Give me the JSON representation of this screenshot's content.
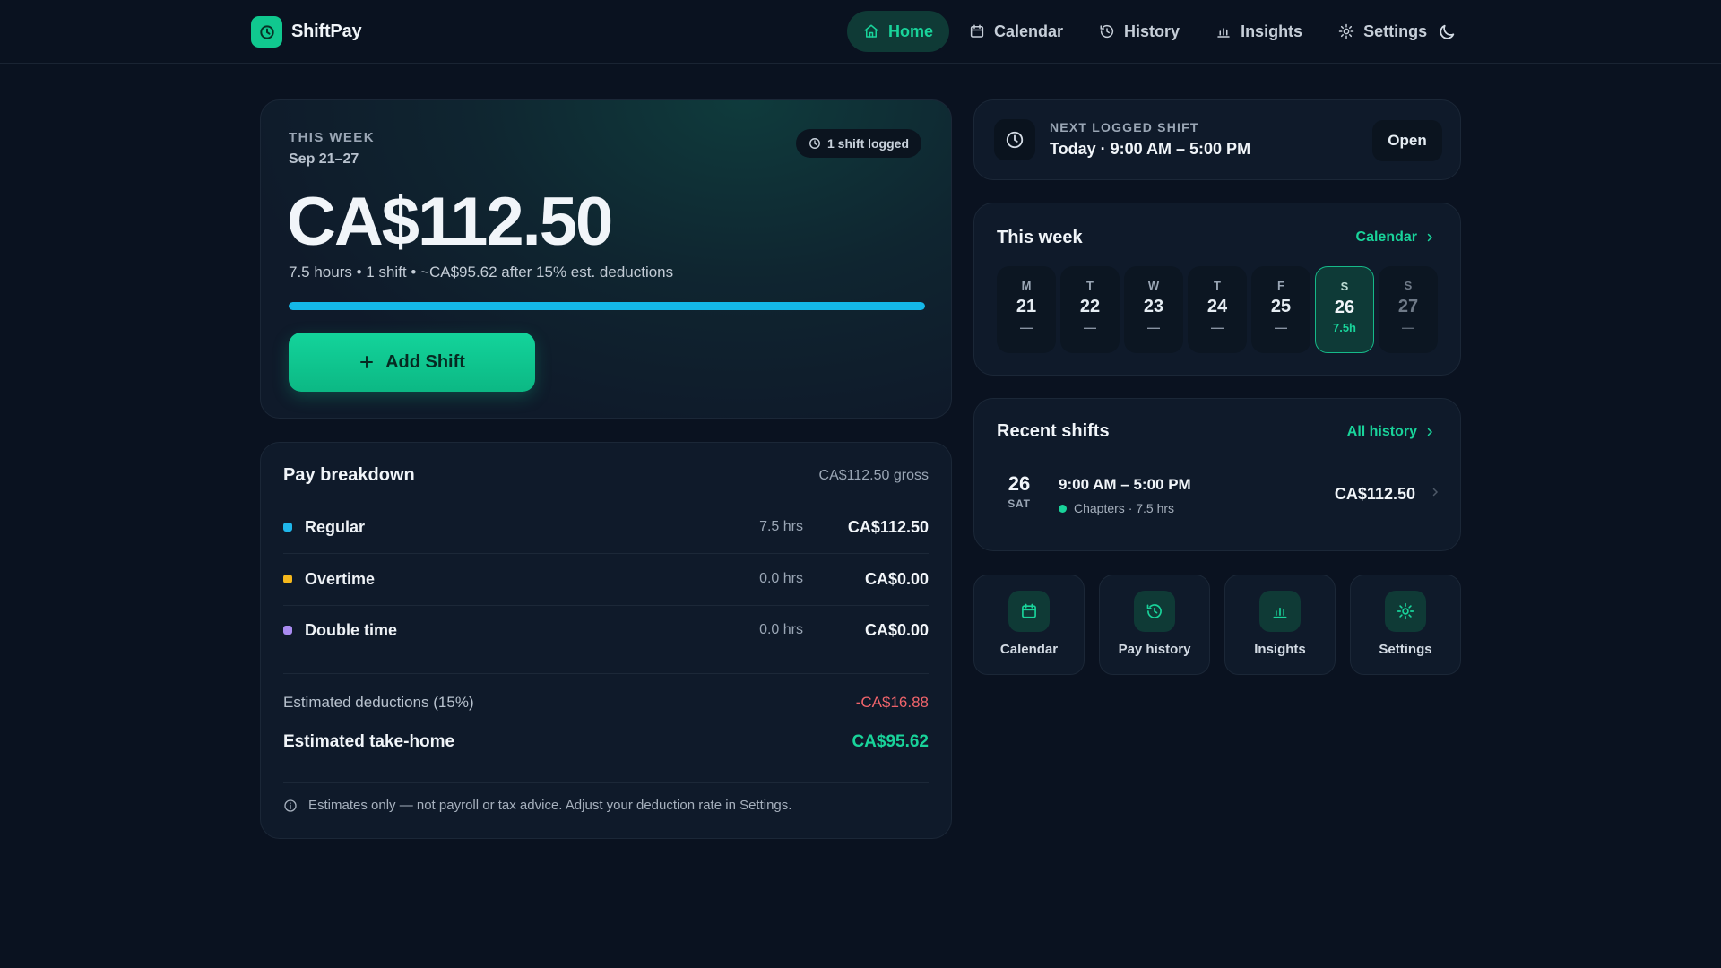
{
  "app": {
    "name": "ShiftPay",
    "nav": [
      {
        "label": "Home",
        "icon": "home-icon",
        "active": true
      },
      {
        "label": "Calendar",
        "icon": "calendar-icon"
      },
      {
        "label": "History",
        "icon": "history-icon"
      },
      {
        "label": "Insights",
        "icon": "bar-chart-icon"
      },
      {
        "label": "Settings",
        "icon": "gear-icon"
      }
    ],
    "theme_toggle_icon": "moon-icon"
  },
  "hero": {
    "label": "THIS WEEK",
    "range": "Sep 21–27",
    "badge": "1 shift logged",
    "amount": "CA$112.50",
    "summary": "7.5 hours • 1 shift • ~CA$95.62 after 15% est. deductions",
    "progress_percent": 100,
    "add_button": "Add Shift"
  },
  "breakdown": {
    "title": "Pay breakdown",
    "gross": "CA$112.50 gross",
    "rows": [
      {
        "name": "Regular",
        "hours": "7.5 hrs",
        "value": "CA$112.50",
        "color": "#1fb6ea"
      },
      {
        "name": "Overtime",
        "hours": "0.0 hrs",
        "value": "CA$0.00",
        "color": "#f5b81c"
      },
      {
        "name": "Double time",
        "hours": "0.0 hrs",
        "value": "CA$0.00",
        "color": "#a98bf0"
      }
    ],
    "deductions_label": "Estimated deductions (15%)",
    "deductions_value": "-CA$16.88",
    "takehome_label": "Estimated take-home",
    "takehome_value": "CA$95.62",
    "disclaimer": "Estimates only — not payroll or tax advice. Adjust your deduction rate in Settings."
  },
  "next_shift": {
    "label": "NEXT LOGGED SHIFT",
    "time": "Today · 9:00 AM – 5:00 PM",
    "open_label": "Open"
  },
  "week": {
    "title": "This week",
    "link": "Calendar",
    "days": [
      {
        "dow": "M",
        "num": "21",
        "hours": "—"
      },
      {
        "dow": "T",
        "num": "22",
        "hours": "—"
      },
      {
        "dow": "W",
        "num": "23",
        "hours": "—"
      },
      {
        "dow": "T",
        "num": "24",
        "hours": "—"
      },
      {
        "dow": "F",
        "num": "25",
        "hours": "—"
      },
      {
        "dow": "S",
        "num": "26",
        "hours": "7.5h",
        "active": true
      },
      {
        "dow": "S",
        "num": "27",
        "hours": "—",
        "dim": true
      }
    ]
  },
  "recent": {
    "title": "Recent shifts",
    "link": "All history",
    "shift": {
      "day_num": "26",
      "day_dow": "SAT",
      "time": "9:00 AM – 5:00 PM",
      "meta": "Chapters · 7.5 hrs",
      "amount": "CA$112.50"
    }
  },
  "quick_actions": [
    {
      "label": "Calendar",
      "icon": "calendar-icon"
    },
    {
      "label": "Pay history",
      "icon": "history-icon"
    },
    {
      "label": "Insights",
      "icon": "bar-chart-icon"
    },
    {
      "label": "Settings",
      "icon": "gear-icon"
    }
  ],
  "colors": {
    "accent": "#19d39a",
    "background": "#0a1220",
    "card": "#0f1a2a",
    "negative": "#f0646b",
    "progress": "#14b8e8"
  }
}
